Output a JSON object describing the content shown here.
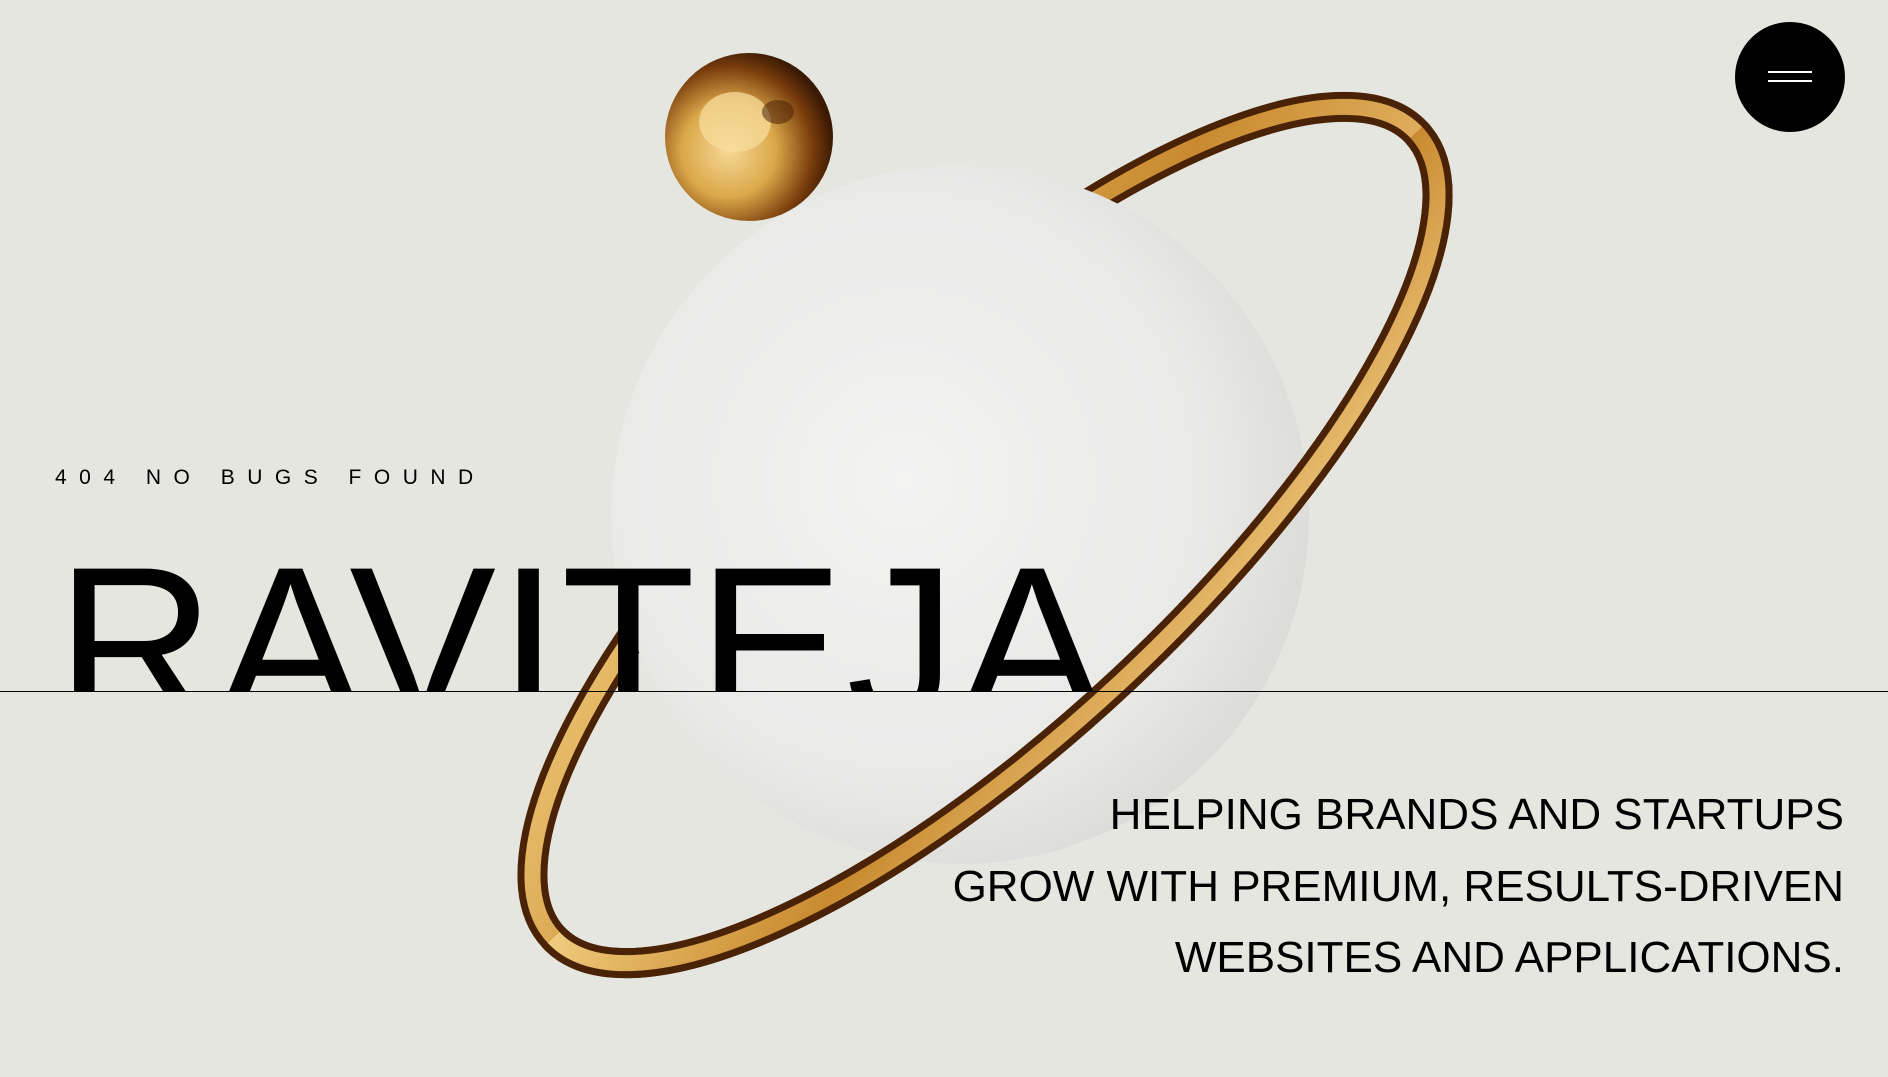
{
  "header": {
    "menu_icon": "hamburger-menu-icon"
  },
  "hero": {
    "eyebrow": "404 NO BUGS FOUND",
    "name": "RAVITEJA",
    "tagline": [
      "HELPING BRANDS AND STARTUPS",
      "GROW WITH PREMIUM, RESULTS-DRIVEN",
      "WEBSITES AND APPLICATIONS."
    ]
  },
  "colors": {
    "background": "#e5e6e0",
    "text": "#000000",
    "gold_light": "#f3d38a",
    "gold_dark": "#4a2206",
    "planet": "#ebebea"
  }
}
